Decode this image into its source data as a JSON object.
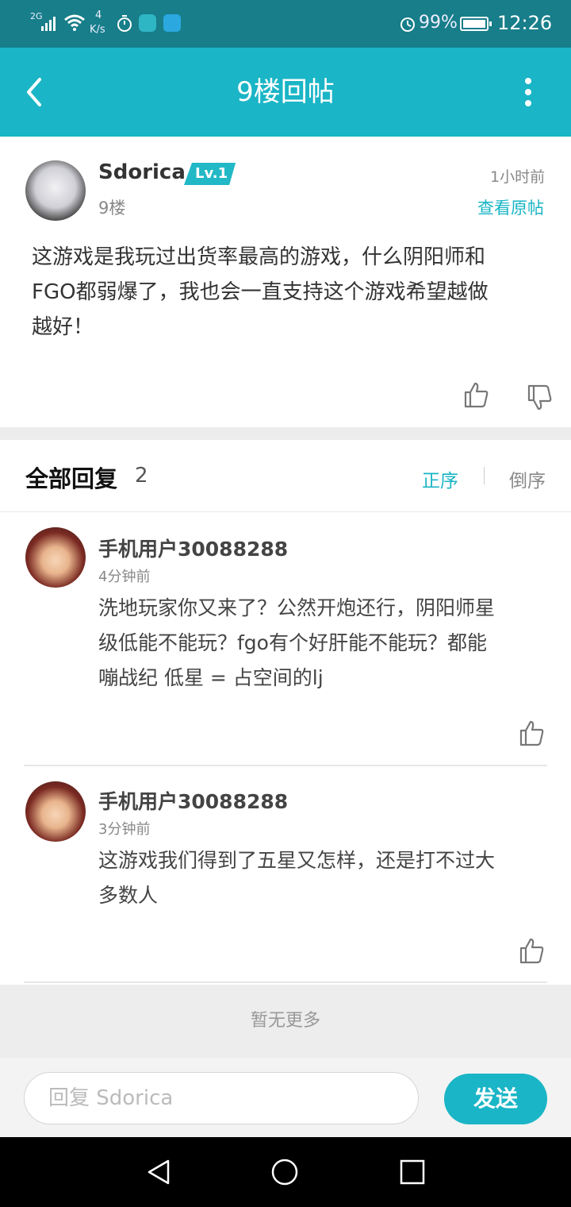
{
  "status_bar": {
    "network": "2G",
    "speed_value": "4",
    "speed_unit": "K/s",
    "battery": "99%",
    "time": "12:26"
  },
  "header": {
    "title": "9楼回帖"
  },
  "post": {
    "username": "Sdorica",
    "level": "Lv.1",
    "floor": "9楼",
    "time": "1小时前",
    "view_original": "查看原帖",
    "content_lines": [
      "这游戏是我玩过出货率最高的游戏，什么阴阳师和",
      "FGO都弱爆了，我也会一直支持这个游戏希望越做",
      "越好！"
    ]
  },
  "replies_section": {
    "title": "全部回复",
    "count": "2",
    "sort_asc": "正序",
    "sort_desc": "倒序"
  },
  "replies": [
    {
      "username": "手机用户30088288",
      "time": "4分钟前",
      "lines": [
        "洗地玩家你又来了？公然开炮还行，阴阳师星",
        "级低能不能玩？fgo有个好肝能不能玩？都能",
        "嘣战纪 低星 = 占空间的lj"
      ]
    },
    {
      "username": "手机用户30088288",
      "time": "3分钟前",
      "lines": [
        "这游戏我们得到了五星又怎样，还是打不过大",
        "多数人"
      ]
    }
  ],
  "no_more": "暂无更多",
  "composer": {
    "placeholder": "回复 Sdorica",
    "send": "发送"
  },
  "colors": {
    "accent": "#1ab5c6",
    "status_bar": "#177e8a"
  },
  "icons": [
    "back-icon",
    "more-icon",
    "thumbs-up-icon",
    "thumbs-down-icon",
    "nav-back-icon",
    "nav-home-icon",
    "nav-recents-icon"
  ]
}
